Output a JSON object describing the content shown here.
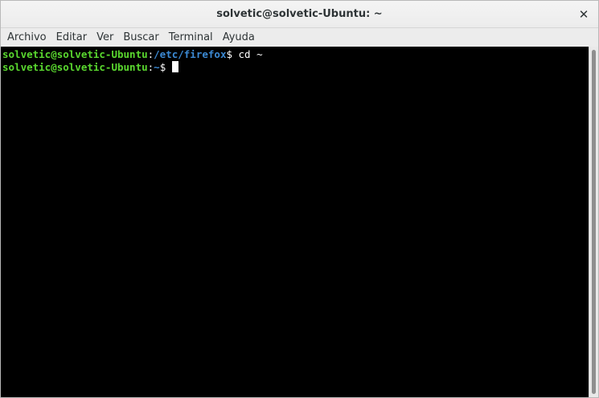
{
  "window": {
    "title": "solvetic@solvetic-Ubuntu: ~",
    "close_glyph": "✕"
  },
  "menu": {
    "items": [
      "Archivo",
      "Editar",
      "Ver",
      "Buscar",
      "Terminal",
      "Ayuda"
    ]
  },
  "terminal": {
    "lines": [
      {
        "user": "solvetic@solvetic-Ubuntu",
        "sep": ":",
        "path": "/etc/firefox",
        "prompt": "$ ",
        "command": "cd ~"
      },
      {
        "user": "solvetic@solvetic-Ubuntu",
        "sep": ":",
        "path": "~",
        "prompt": "$ ",
        "command": ""
      }
    ]
  },
  "colors": {
    "user": "#5ad82f",
    "path": "#3c8ad4",
    "background": "#000000",
    "text": "#ffffff"
  },
  "icons": {
    "close": "close-icon",
    "cursor": "terminal-cursor"
  }
}
